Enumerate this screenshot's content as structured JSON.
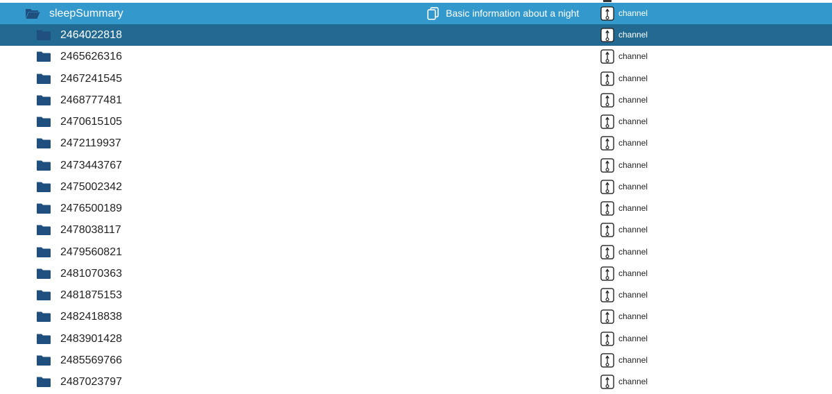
{
  "colors": {
    "root_row_bg": "#3399cc",
    "selected_row_bg": "#236a93",
    "folder_icon": "#1f4f7f",
    "text_dark": "#222222",
    "text_light": "#ffffff"
  },
  "root": {
    "name": "sleepSummary",
    "icon": "folder-open-icon",
    "description_icon": "copy-documents-icon",
    "description": "Basic information about a night",
    "channel_icon": "channel-icon",
    "channel_label": "channel"
  },
  "selected_index": 0,
  "items": [
    {
      "name": "2464022818",
      "channel_label": "channel"
    },
    {
      "name": "2465626316",
      "channel_label": "channel"
    },
    {
      "name": "2467241545",
      "channel_label": "channel"
    },
    {
      "name": "2468777481",
      "channel_label": "channel"
    },
    {
      "name": "2470615105",
      "channel_label": "channel"
    },
    {
      "name": "2472119937",
      "channel_label": "channel"
    },
    {
      "name": "2473443767",
      "channel_label": "channel"
    },
    {
      "name": "2475002342",
      "channel_label": "channel"
    },
    {
      "name": "2476500189",
      "channel_label": "channel"
    },
    {
      "name": "2478038117",
      "channel_label": "channel"
    },
    {
      "name": "2479560821",
      "channel_label": "channel"
    },
    {
      "name": "2481070363",
      "channel_label": "channel"
    },
    {
      "name": "2481875153",
      "channel_label": "channel"
    },
    {
      "name": "2482418838",
      "channel_label": "channel"
    },
    {
      "name": "2483901428",
      "channel_label": "channel"
    },
    {
      "name": "2485569766",
      "channel_label": "channel"
    },
    {
      "name": "2487023797",
      "channel_label": "channel"
    }
  ]
}
